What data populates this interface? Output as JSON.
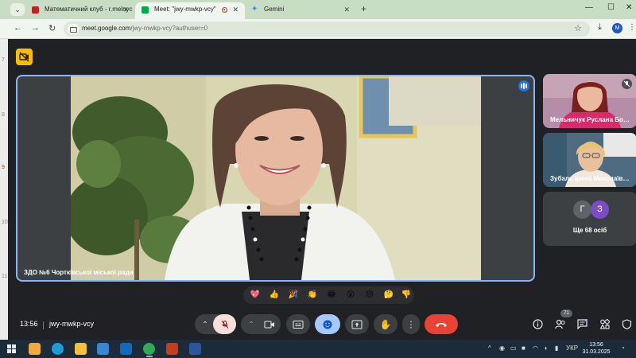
{
  "browser": {
    "tabs": [
      {
        "label": "Математичний клуб - r.melnyc",
        "active": false
      },
      {
        "label": "Meet: \"jwy-mwkp-vcy\"",
        "active": true
      },
      {
        "label": "Gemini",
        "active": false
      }
    ],
    "url_host": "meet.google.com",
    "url_path": "/jwy-mwkp-vcy?authuser=0",
    "profile_initial": "M"
  },
  "behind_window": {
    "line_numbers": [
      "7",
      "8",
      "9",
      "10",
      "11"
    ]
  },
  "meet": {
    "main_participant": "ЗДО №6 Чортківської міської ради",
    "participants": [
      {
        "name": "Мельничук Руслана Бо…"
      },
      {
        "name": "Зубаль Ірина Миколаїв…"
      }
    ],
    "others": {
      "avatars": [
        "Г",
        "З"
      ],
      "label": "Ще 68 осіб"
    },
    "reactions": [
      "💖",
      "👍",
      "🎉",
      "👏",
      "😂",
      "😮",
      "😢",
      "🤔",
      "👎"
    ],
    "time": "13:56",
    "meeting_code": "jwy-mwkp-vcy",
    "participants_count": "71"
  },
  "taskbar": {
    "language": "УКР",
    "time": "13:56",
    "date": "31.03.2025"
  },
  "colors": {
    "accent": "#8ab4f8",
    "end_call": "#ea4335",
    "mic_off_bg": "#f9dedc",
    "reactions_active": "#a8c7fa",
    "warning": "#fbbc04"
  }
}
